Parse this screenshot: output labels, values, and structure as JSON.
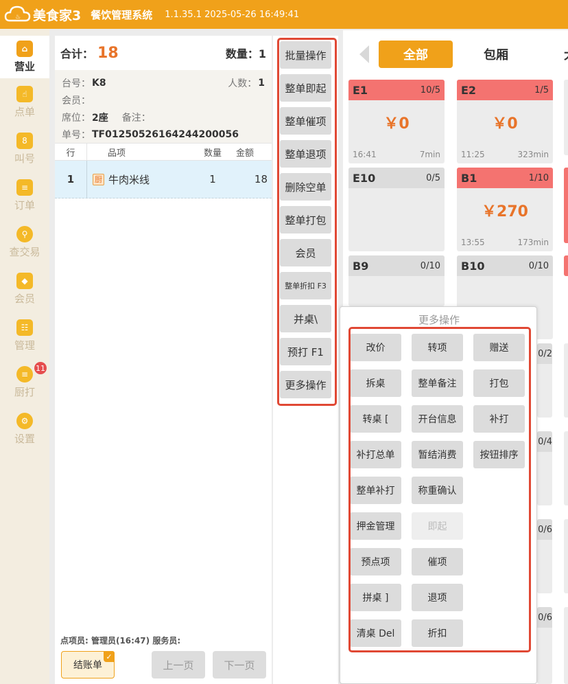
{
  "app": {
    "logo_text": "美食家3",
    "title": "餐饮管理系统",
    "version": "1.1.35.1 2025-05-26 16:49:41"
  },
  "nav": [
    {
      "label": "营业",
      "icon": "shop-icon"
    },
    {
      "label": "点单",
      "icon": "hand-pointer-icon"
    },
    {
      "label": "叫号",
      "icon": "ticket-icon",
      "glyph": "8"
    },
    {
      "label": "订单",
      "icon": "list-icon"
    },
    {
      "label": "查交易",
      "icon": "magnifier-icon"
    },
    {
      "label": "会员",
      "icon": "diamond-icon"
    },
    {
      "label": "管理",
      "icon": "checklist-icon"
    },
    {
      "label": "厨打",
      "icon": "printer-icon",
      "badge": "11"
    },
    {
      "label": "设置",
      "icon": "gear-icon"
    }
  ],
  "order": {
    "total_label": "合计：",
    "total_value": "18",
    "qty_label": "数量：",
    "qty_value": "1",
    "table_label": "台号：",
    "table_value": "K8",
    "people_label": "人数：",
    "people_value": "1",
    "member_label": "会员：",
    "seat_label": "席位：",
    "seat_value": "2座",
    "note_label": "备注：",
    "order_no_label": "单号：",
    "order_no_value": "TF01250526164244200056",
    "columns": [
      "行",
      "品项",
      "数量",
      "金额"
    ],
    "items": [
      {
        "line": "1",
        "badge": "厨",
        "name": "牛肉米线",
        "qty": "1",
        "amount": "18"
      }
    ],
    "staff_text": "点项员:  管理员(16:47)    服务员:",
    "checkout_label": "结账单",
    "prev_label": "上一页",
    "next_label": "下一页"
  },
  "actions": [
    "批量操作",
    "整单即起",
    "整单催项",
    "整单退项",
    "删除空单",
    "整单打包",
    "会员",
    "整单折扣 F3",
    "并桌\\",
    "预打 F1",
    "更多操作"
  ],
  "tabs": {
    "all": "全部",
    "private_room": "包厢",
    "partial": "大"
  },
  "tables": [
    {
      "name": "E1",
      "cap": "10/5",
      "busy": true,
      "price": "￥0",
      "time": "16:41",
      "dur": "7min"
    },
    {
      "name": "E2",
      "cap": "1/5",
      "busy": true,
      "price": "￥0",
      "time": "11:25",
      "dur": "323min"
    },
    {
      "name": "E10",
      "cap": "0/5",
      "busy": false
    },
    {
      "name": "B1",
      "cap": "1/10",
      "busy": true,
      "price": "￥270",
      "time": "13:55",
      "dur": "173min"
    },
    {
      "name": "B9",
      "cap": "0/10",
      "busy": false
    },
    {
      "name": "B10",
      "cap": "0/10",
      "busy": false
    }
  ],
  "hidden_caps": [
    "0/2",
    "0/4",
    "0/6",
    "0/6"
  ],
  "more": {
    "title": "更多操作",
    "buttons": [
      "改价",
      "转项",
      "赠送",
      "拆桌",
      "整单备注",
      "打包",
      "转桌 [",
      "开台信息",
      "补打",
      "补打总单",
      "暂结消费",
      "按钮排序",
      "整单补打",
      "称重确认",
      "押金管理",
      "即起",
      "预点项",
      "催项",
      "拼桌 ]",
      "退项",
      "清桌 Del",
      "折扣"
    ]
  },
  "colors": {
    "brand": "#f0a11a",
    "busy": "#f47370",
    "price": "#e8742a",
    "highlight": "#e04834"
  }
}
